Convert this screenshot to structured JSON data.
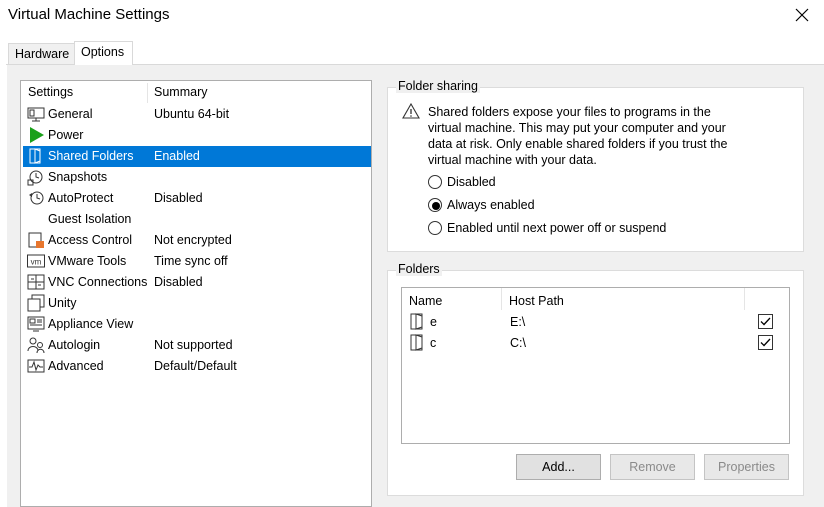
{
  "window": {
    "title": "Virtual Machine Settings"
  },
  "tabs": [
    {
      "label": "Hardware",
      "active": false
    },
    {
      "label": "Options",
      "active": true
    }
  ],
  "settings_list": {
    "headers": {
      "settings": "Settings",
      "summary": "Summary"
    },
    "items": [
      {
        "name": "General",
        "summary": "Ubuntu 64-bit",
        "icon": "monitor-icon"
      },
      {
        "name": "Power",
        "summary": "",
        "icon": "play-icon"
      },
      {
        "name": "Shared Folders",
        "summary": "Enabled",
        "icon": "shared-folder-icon",
        "selected": true
      },
      {
        "name": "Snapshots",
        "summary": "",
        "icon": "snapshot-icon"
      },
      {
        "name": "AutoProtect",
        "summary": "Disabled",
        "icon": "clock-icon"
      },
      {
        "name": "Guest Isolation",
        "summary": "",
        "icon": "isolation-icon"
      },
      {
        "name": "Access Control",
        "summary": "Not encrypted",
        "icon": "lock-icon"
      },
      {
        "name": "VMware Tools",
        "summary": "Time sync off",
        "icon": "vm-icon"
      },
      {
        "name": "VNC Connections",
        "summary": "Disabled",
        "icon": "network-icon"
      },
      {
        "name": "Unity",
        "summary": "",
        "icon": "unity-icon"
      },
      {
        "name": "Appliance View",
        "summary": "",
        "icon": "appliance-icon"
      },
      {
        "name": "Autologin",
        "summary": "Not supported",
        "icon": "users-icon"
      },
      {
        "name": "Advanced",
        "summary": "Default/Default",
        "icon": "graph-icon"
      }
    ]
  },
  "folder_sharing": {
    "title": "Folder sharing",
    "warning": "Shared folders expose your files to programs in the virtual machine. This may put your computer and your data at risk. Only enable shared folders if you trust the virtual machine with your data.",
    "options": [
      {
        "label": "Disabled",
        "checked": false
      },
      {
        "label": "Always enabled",
        "checked": true
      },
      {
        "label": "Enabled until next power off or suspend",
        "checked": false
      }
    ]
  },
  "folders": {
    "title": "Folders",
    "headers": {
      "name": "Name",
      "host_path": "Host Path"
    },
    "rows": [
      {
        "name": "e",
        "path": "E:\\",
        "enabled": true
      },
      {
        "name": "c",
        "path": "C:\\",
        "enabled": true
      }
    ],
    "buttons": {
      "add": "Add...",
      "remove": "Remove",
      "properties": "Properties"
    }
  },
  "colors": {
    "selection": "#0078d7",
    "panel": "#f0f0f0",
    "play": "#1aa01a",
    "lock_accent": "#e8762d"
  }
}
